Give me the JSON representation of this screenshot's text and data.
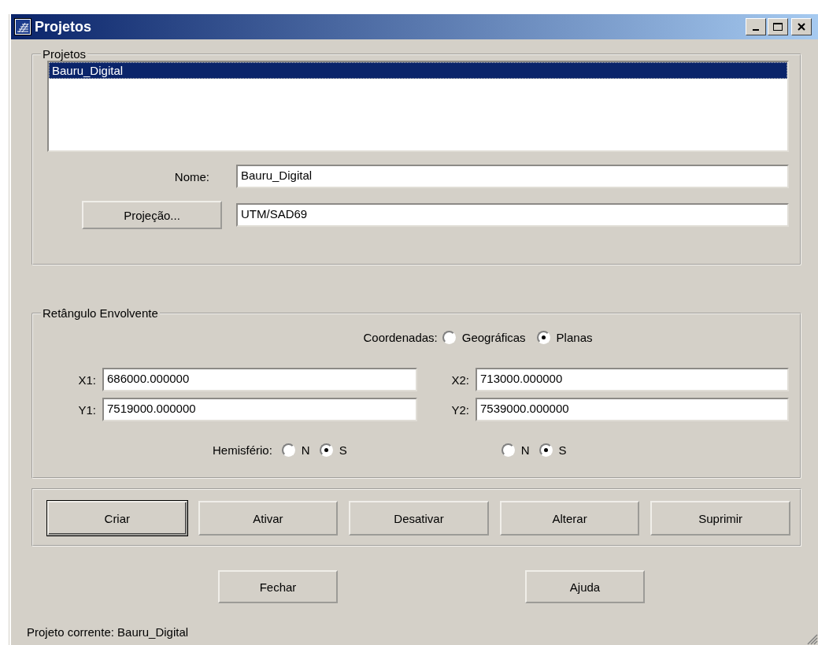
{
  "window": {
    "title": "Projetos"
  },
  "projects_group": {
    "title": "Projetos",
    "list": [
      {
        "label": "Bauru_Digital",
        "selected": true
      }
    ],
    "name_label": "Nome:",
    "name_value": "Bauru_Digital",
    "projection_button": "Projeção...",
    "projection_value": "UTM/SAD69"
  },
  "bounds_group": {
    "title": "Retângulo Envolvente",
    "coordinates_label": "Coordenadas:",
    "coordinate_options": [
      {
        "label": "Geográficas",
        "selected": false
      },
      {
        "label": "Planas",
        "selected": true
      }
    ],
    "fields": [
      {
        "label": "X1:",
        "value": "686000.000000"
      },
      {
        "label": "X2:",
        "value": "713000.000000"
      },
      {
        "label": "Y1:",
        "value": "7519000.000000"
      },
      {
        "label": "Y2:",
        "value": "7539000.000000"
      }
    ],
    "hemisphere_label": "Hemisfério:",
    "hemisphere_left": [
      {
        "label": "N",
        "selected": false
      },
      {
        "label": "S",
        "selected": true
      }
    ],
    "hemisphere_right": [
      {
        "label": "N",
        "selected": false
      },
      {
        "label": "S",
        "selected": true
      }
    ]
  },
  "actions": [
    {
      "label": "Criar",
      "default": true
    },
    {
      "label": "Ativar",
      "default": false
    },
    {
      "label": "Desativar",
      "default": false
    },
    {
      "label": "Alterar",
      "default": false
    },
    {
      "label": "Suprimir",
      "default": false
    }
  ],
  "bottom_buttons": [
    "Fechar",
    "Ajuda"
  ],
  "status": "Projeto corrente: Bauru_Digital"
}
